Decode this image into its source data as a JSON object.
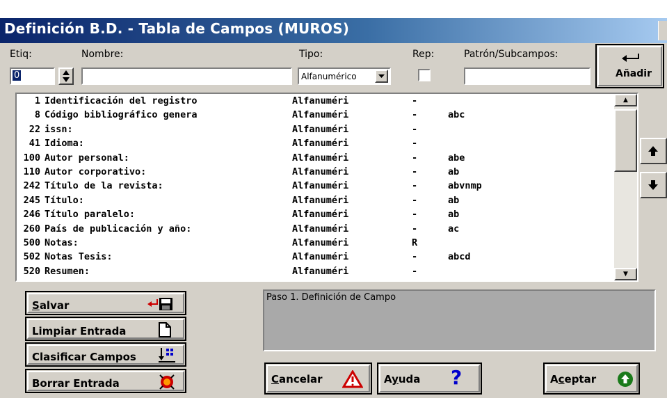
{
  "window": {
    "title": "Definición B.D.  - Tabla de Campos (MUROS)"
  },
  "form": {
    "etiq_label": "Etiq:",
    "nombre_label": "Nombre:",
    "tipo_label": "Tipo:",
    "rep_label": "Rep:",
    "patron_label": "Patrón/Subcampos:",
    "etiq_value": "0",
    "nombre_value": "",
    "tipo_value": "Alfanumérico",
    "rep_checked": false,
    "patron_value": ""
  },
  "anadir_button": {
    "icon": "enter-arrow-icon",
    "label": "Añadir"
  },
  "fields": [
    {
      "num": "1",
      "name": "Identificación del registro",
      "type": "Alfanuméri",
      "rep": "-",
      "pattern": ""
    },
    {
      "num": "8",
      "name": "Código bibliográfico genera",
      "type": "Alfanuméri",
      "rep": "-",
      "pattern": "abc"
    },
    {
      "num": "22",
      "name": "issn:",
      "type": "Alfanuméri",
      "rep": "-",
      "pattern": ""
    },
    {
      "num": "41",
      "name": "Idioma:",
      "type": "Alfanuméri",
      "rep": "-",
      "pattern": ""
    },
    {
      "num": "100",
      "name": "Autor personal:",
      "type": "Alfanuméri",
      "rep": "-",
      "pattern": "abe"
    },
    {
      "num": "110",
      "name": "Autor corporativo:",
      "type": "Alfanuméri",
      "rep": "-",
      "pattern": "ab"
    },
    {
      "num": "242",
      "name": "Título de la revista:",
      "type": "Alfanuméri",
      "rep": "-",
      "pattern": "abvnmp"
    },
    {
      "num": "245",
      "name": "Título:",
      "type": "Alfanuméri",
      "rep": "-",
      "pattern": "ab"
    },
    {
      "num": "246",
      "name": "Título paralelo:",
      "type": "Alfanuméri",
      "rep": "-",
      "pattern": "ab"
    },
    {
      "num": "260",
      "name": "País de publicación y año:",
      "type": "Alfanuméri",
      "rep": "-",
      "pattern": "ac"
    },
    {
      "num": "500",
      "name": "Notas:",
      "type": "Alfanuméri",
      "rep": "R",
      "pattern": ""
    },
    {
      "num": "502",
      "name": "Notas Tesis:",
      "type": "Alfanuméri",
      "rep": "-",
      "pattern": "abcd"
    },
    {
      "num": "520",
      "name": "Resumen:",
      "type": "Alfanuméri",
      "rep": "-",
      "pattern": ""
    }
  ],
  "buttons": {
    "salvar_pre": "",
    "salvar_ul": "S",
    "salvar_post": "alvar",
    "limpiar": "Limpiar Entrada",
    "clasificar": "Clasificar Campos",
    "borrar": "Borrar Entrada",
    "cancelar_ul": "C",
    "cancelar_post": "ancelar",
    "ayuda_pre": "A",
    "ayuda_ul": "y",
    "ayuda_post": "uda",
    "aceptar_pre": "A",
    "aceptar_ul": "c",
    "aceptar_post": "eptar"
  },
  "status": {
    "message": "Paso 1. Definición de Campo"
  },
  "icons": {
    "salvar": "save-disk-icon",
    "limpiar": "blank-page-icon",
    "clasificar": "sort-icon",
    "borrar": "erase-icon",
    "cancelar": "warning-triangle-icon",
    "ayuda": "question-mark-icon",
    "aceptar": "green-up-arrow-icon",
    "move_up": "up-arrow-icon",
    "move_down": "down-arrow-icon"
  },
  "colors": {
    "title_start": "#0a246a",
    "title_end": "#a6caf0",
    "face": "#d4d0c8",
    "warning_red": "#cc0000",
    "help_blue": "#0000cc",
    "accept_green": "#1a7a1a"
  }
}
